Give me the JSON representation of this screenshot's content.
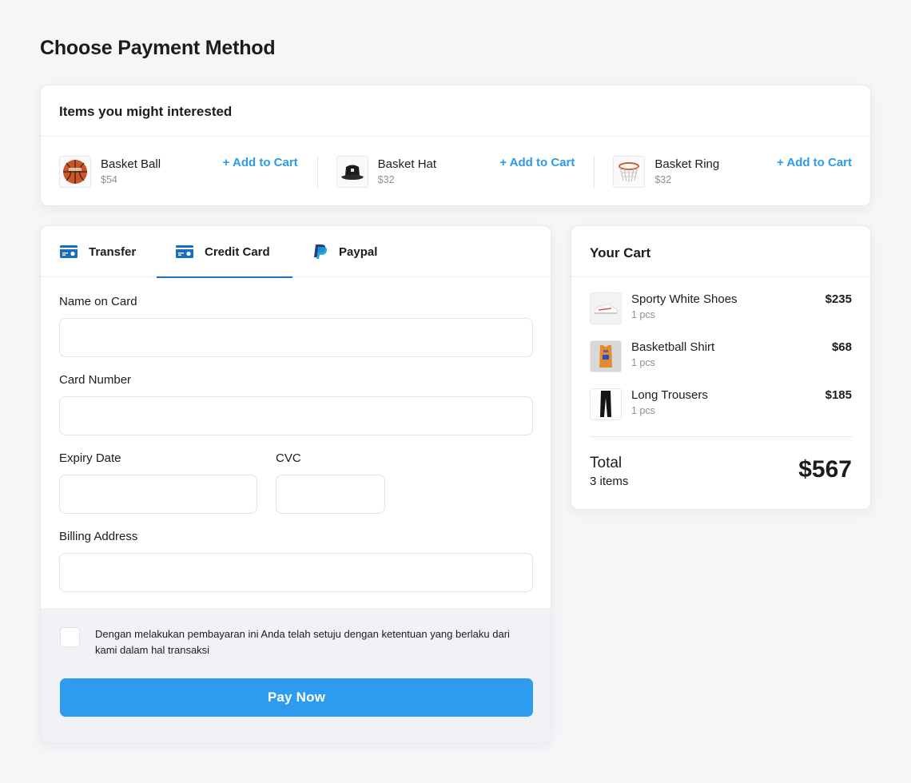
{
  "page": {
    "title": "Choose Payment Method"
  },
  "suggestions": {
    "title": "Items you might interested",
    "items": [
      {
        "name": "Basket Ball",
        "price": "$54",
        "action": "+ Add to Cart",
        "icon": "basketball-icon"
      },
      {
        "name": "Basket Hat",
        "price": "$32",
        "action": "+ Add to Cart",
        "icon": "bucket-hat-icon"
      },
      {
        "name": "Basket Ring",
        "price": "$32",
        "action": "+ Add to Cart",
        "icon": "basketball-hoop-icon"
      }
    ]
  },
  "payment": {
    "tabs": [
      {
        "label": "Transfer",
        "icon": "bank-card-icon",
        "active": false
      },
      {
        "label": "Credit Card",
        "icon": "credit-card-icon",
        "active": true
      },
      {
        "label": "Paypal",
        "icon": "paypal-icon",
        "active": false
      }
    ],
    "form": {
      "name_label": "Name on Card",
      "name_value": "",
      "name_placeholder": "",
      "number_label": "Card Number",
      "number_value": "",
      "number_placeholder": "",
      "expiry_label": "Expiry Date",
      "expiry_value": "",
      "expiry_placeholder": "",
      "cvc_label": "CVC",
      "cvc_value": "",
      "cvc_placeholder": "",
      "address_label": "Billing Address",
      "address_value": "",
      "address_placeholder": ""
    },
    "agreement": {
      "checked": false,
      "text": "Dengan melakukan pembayaran ini Anda telah setuju dengan ketentuan yang berlaku dari kami dalam hal transaksi"
    },
    "pay_button": "Pay Now"
  },
  "cart": {
    "title": "Your Cart",
    "items": [
      {
        "name": "Sporty White Shoes",
        "qty": "1 pcs",
        "price": "$235",
        "icon": "sneaker-icon"
      },
      {
        "name": "Basketball Shirt",
        "qty": "1 pcs",
        "price": "$68",
        "icon": "jersey-icon"
      },
      {
        "name": "Long Trousers",
        "qty": "1 pcs",
        "price": "$185",
        "icon": "trousers-icon"
      }
    ],
    "total_label": "Total",
    "total_count": "3 items",
    "total_value": "$567"
  },
  "colors": {
    "accent": "#2d9bef",
    "link": "#2e9ae9",
    "tab_underline": "#1c6fbe",
    "background": "#f5f6f8"
  }
}
